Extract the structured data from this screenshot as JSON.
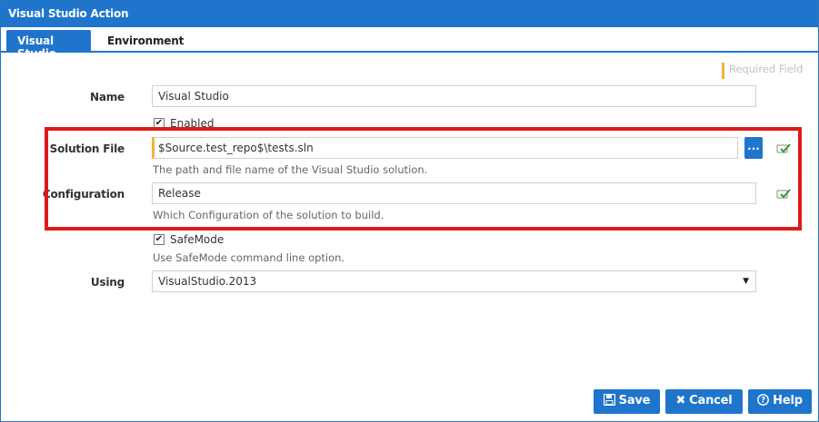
{
  "window": {
    "title": "Visual Studio Action"
  },
  "tabs": [
    {
      "label": "Visual Studio"
    },
    {
      "label": "Environment"
    }
  ],
  "legend": {
    "required_label": "Required Field"
  },
  "form": {
    "name": {
      "label": "Name",
      "value": "Visual Studio"
    },
    "enabled": {
      "label": "Enabled",
      "checked": true
    },
    "solution_file": {
      "label": "Solution File",
      "value": "$Source.test_repo$\\tests.sln",
      "browse_label": "...",
      "help": "The path and file name of the Visual Studio solution."
    },
    "configuration": {
      "label": "Configuration",
      "value": "Release",
      "help": "Which Configuration of the solution to build."
    },
    "safemode": {
      "label": "SafeMode",
      "checked": true,
      "help": "Use SafeMode command line option."
    },
    "using": {
      "label": "Using",
      "selected": "VisualStudio.2013"
    }
  },
  "buttons": {
    "save": "Save",
    "cancel": "Cancel",
    "help": "Help"
  },
  "colors": {
    "accent": "#1f75cc",
    "required": "#f3b13c",
    "highlight": "#e01818",
    "valid": "#2e9e2e"
  }
}
